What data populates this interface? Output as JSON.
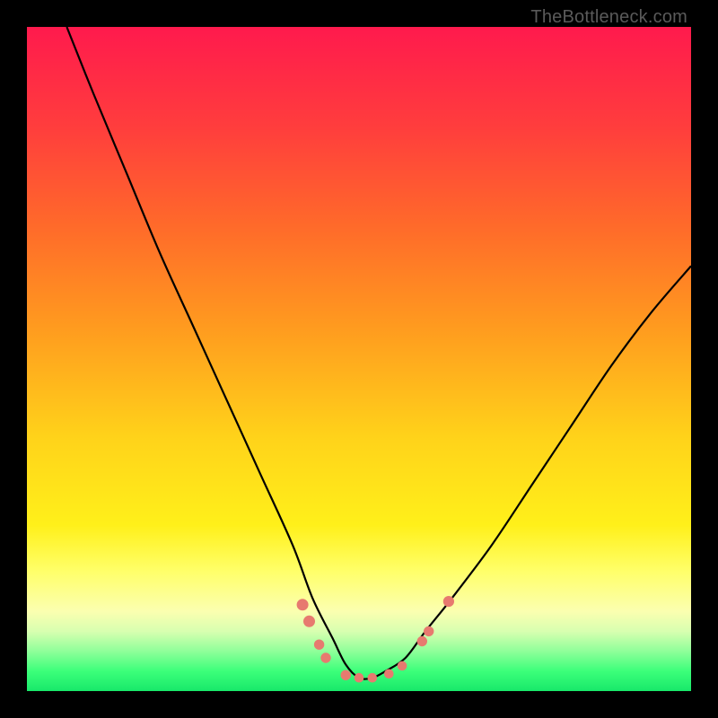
{
  "attribution": "TheBottleneck.com",
  "chart_data": {
    "type": "line",
    "title": "",
    "xlabel": "",
    "ylabel": "",
    "xlim": [
      0,
      100
    ],
    "ylim": [
      0,
      100
    ],
    "series": [
      {
        "name": "curve",
        "x": [
          6,
          10,
          15,
          20,
          25,
          30,
          35,
          40,
          43,
          46,
          48,
          50,
          52,
          54,
          57,
          60,
          64,
          70,
          76,
          82,
          88,
          94,
          100
        ],
        "y": [
          100,
          90,
          78,
          66,
          55,
          44,
          33,
          22,
          14,
          8,
          4,
          2,
          2,
          3,
          5,
          9,
          14,
          22,
          31,
          40,
          49,
          57,
          64
        ]
      }
    ],
    "markers": [
      {
        "x": 41.5,
        "y": 13,
        "r": 1.6
      },
      {
        "x": 42.5,
        "y": 10.5,
        "r": 1.6
      },
      {
        "x": 44.0,
        "y": 7,
        "r": 1.4
      },
      {
        "x": 45.0,
        "y": 5,
        "r": 1.4
      },
      {
        "x": 48.0,
        "y": 2.4,
        "r": 1.4
      },
      {
        "x": 50.0,
        "y": 2.0,
        "r": 1.3
      },
      {
        "x": 52.0,
        "y": 2.0,
        "r": 1.3
      },
      {
        "x": 54.5,
        "y": 2.6,
        "r": 1.3
      },
      {
        "x": 56.5,
        "y": 3.8,
        "r": 1.3
      },
      {
        "x": 59.5,
        "y": 7.5,
        "r": 1.4
      },
      {
        "x": 60.5,
        "y": 9.0,
        "r": 1.4
      },
      {
        "x": 63.5,
        "y": 13.5,
        "r": 1.5
      }
    ],
    "colors": {
      "curve": "#000000",
      "markers": "#e77a6f"
    }
  }
}
